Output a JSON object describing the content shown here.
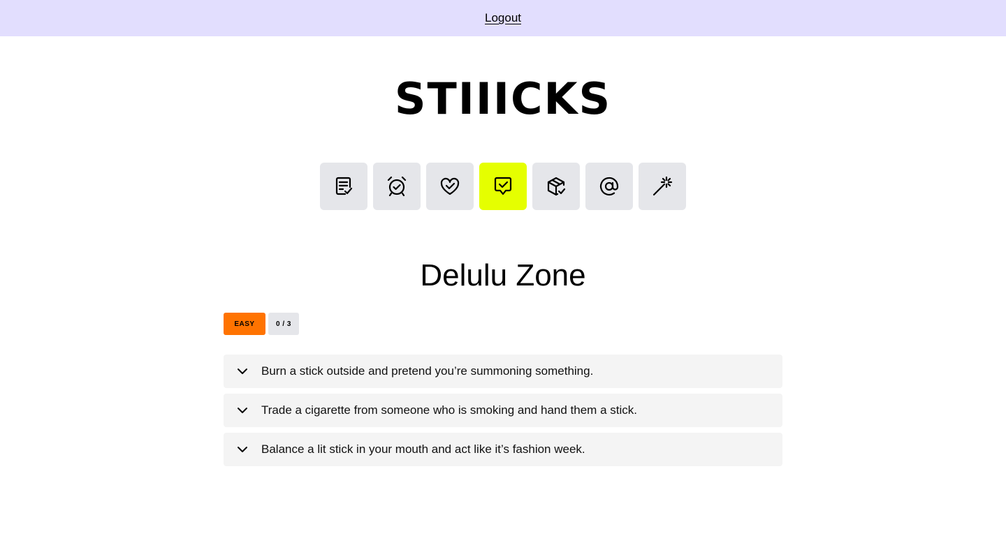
{
  "header": {
    "logout_label": "Logout"
  },
  "brand": {
    "logo_text": "STIIICKS"
  },
  "nav": {
    "items": [
      {
        "icon": "checklist-icon",
        "active": false
      },
      {
        "icon": "alarm-check-icon",
        "active": false
      },
      {
        "icon": "heart-check-icon",
        "active": false
      },
      {
        "icon": "message-check-icon",
        "active": true
      },
      {
        "icon": "package-check-icon",
        "active": false
      },
      {
        "icon": "at-sign-icon",
        "active": false
      },
      {
        "icon": "magic-wand-icon",
        "active": false
      }
    ],
    "active_color": "#e5ff00"
  },
  "section": {
    "title": "Delulu Zone",
    "difficulty": "EASY",
    "difficulty_color": "#ff7300",
    "progress": "0 / 3"
  },
  "tasks": [
    {
      "text": "Burn a stick outside and pretend you’re summoning something."
    },
    {
      "text": "Trade a cigarette from someone who is smoking and hand them a stick."
    },
    {
      "text": "Balance a lit stick in your mouth and act like it’s fashion week."
    }
  ]
}
